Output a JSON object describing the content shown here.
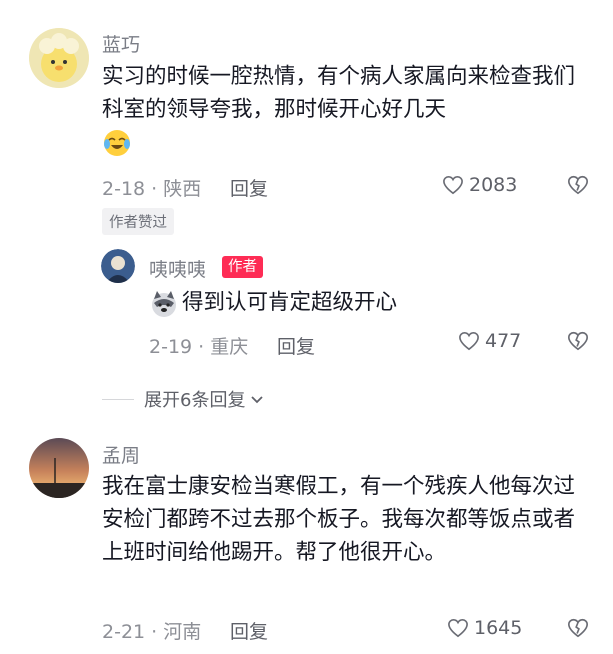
{
  "comments": [
    {
      "username": "蓝巧",
      "text": "实习的时候一腔热情，有个病人家属向来检查我们科室的领导夸我，那时候开心好几天",
      "emoji": "crying-laughing-emoji",
      "meta": "2-18 · 陕西",
      "reply_label": "回复",
      "likes": "2083",
      "tag": "作者赞过"
    },
    {
      "username": "咦咦咦",
      "author_tag": "作者",
      "text": "得到认可肯定超级开心",
      "emoji": "husky-emoji",
      "meta": "2-19 · 重庆",
      "reply_label": "回复",
      "likes": "477"
    },
    {
      "username": "孟周",
      "text": "我在富士康安检当寒假工，有一个残疾人他每次过安检门都跨不过去那个板子。我每次都等饭点或者上班时间给他踢开。帮了他很开心。",
      "meta": "2-21 · 河南",
      "reply_label": "回复",
      "likes": "1645"
    }
  ],
  "expand_replies": "展开6条回复",
  "colors": {
    "author_tag": "#fe2c55",
    "muted": "#8d8f96",
    "text": "#161823"
  }
}
